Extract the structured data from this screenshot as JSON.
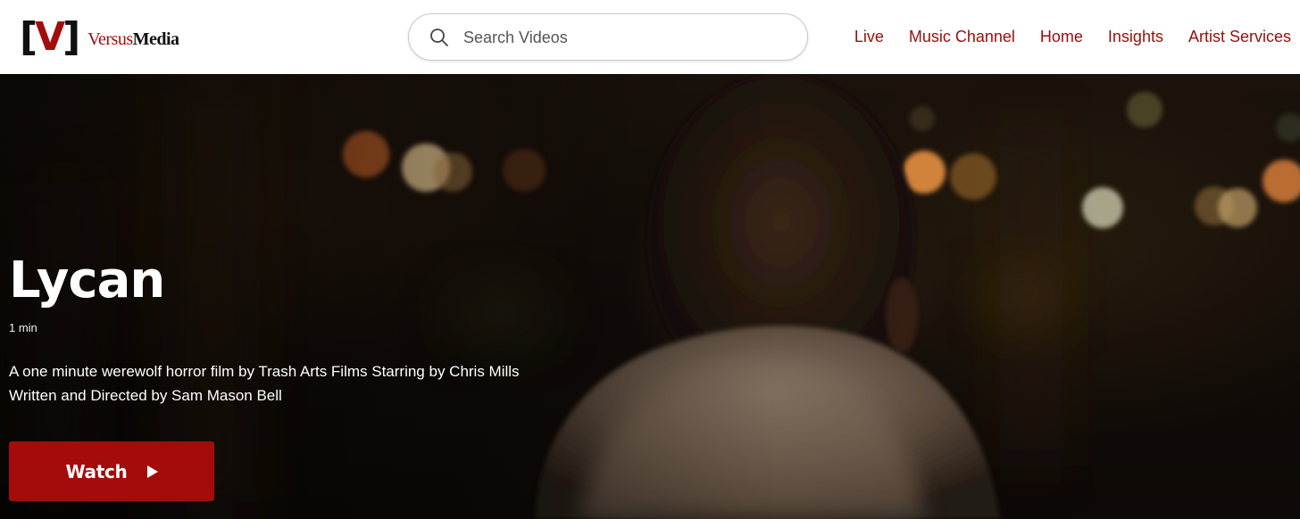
{
  "header": {
    "logo": {
      "mark_left": "[",
      "mark_letter": "V",
      "mark_right": "]",
      "brand_first": "Versus",
      "brand_second": "Media"
    },
    "search": {
      "placeholder": "Search Videos",
      "value": ""
    },
    "nav": [
      {
        "label": "Live"
      },
      {
        "label": "Music Channel"
      },
      {
        "label": "Home"
      },
      {
        "label": "Insights"
      },
      {
        "label": "Artist Services"
      }
    ]
  },
  "hero": {
    "title": "Lycan",
    "duration": "1 min",
    "description_lines": [
      "A one minute werewolf horror film by Trash Arts Films Starring by Chris Mills",
      "Written and Directed by Sam Mason Bell"
    ],
    "watch_label": "Watch"
  },
  "icons": {
    "search": "search-icon",
    "play": "play-icon"
  },
  "colors": {
    "brand_red": "#a40c0c",
    "nav_red": "#9c0c0c",
    "header_bg": "#ffffff",
    "text_light": "#ffffff"
  }
}
